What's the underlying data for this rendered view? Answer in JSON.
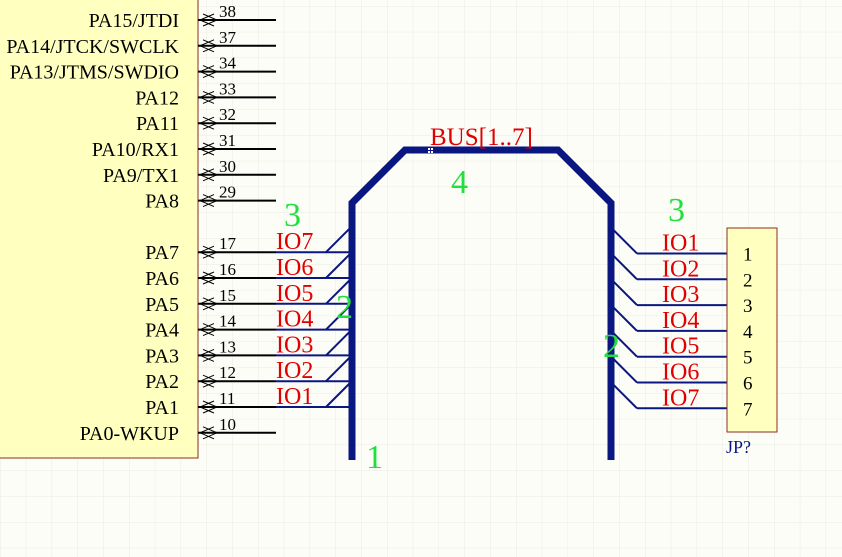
{
  "colors": {
    "background": "#fdfdf8",
    "grid": "#ebebe3",
    "component_fill": "#ffffc0",
    "component_stroke": "#8b2e1e",
    "pin_line": "#000000",
    "bus": "#0b1780",
    "net_label": "#e00000",
    "annotation": "#1fe03c",
    "designator": "#0b1780"
  },
  "mcu": {
    "pins": [
      {
        "name": "PA15/JTDI",
        "number": "38"
      },
      {
        "name": "PA14/JTCK/SWCLK",
        "number": "37"
      },
      {
        "name": "PA13/JTMS/SWDIO",
        "number": "34"
      },
      {
        "name": "PA12",
        "number": "33"
      },
      {
        "name": "PA11",
        "number": "32"
      },
      {
        "name": "PA10/RX1",
        "number": "31"
      },
      {
        "name": "PA9/TX1",
        "number": "30"
      },
      {
        "name": "PA8",
        "number": "29"
      },
      {
        "name": "",
        "number": ""
      },
      {
        "name": "PA7",
        "number": "17",
        "net": "IO7"
      },
      {
        "name": "PA6",
        "number": "16",
        "net": "IO6"
      },
      {
        "name": "PA5",
        "number": "15",
        "net": "IO5"
      },
      {
        "name": "PA4",
        "number": "14",
        "net": "IO4"
      },
      {
        "name": "PA3",
        "number": "13",
        "net": "IO3"
      },
      {
        "name": "PA2",
        "number": "12",
        "net": "IO2"
      },
      {
        "name": "PA1",
        "number": "11",
        "net": "IO1"
      },
      {
        "name": "PA0-WKUP",
        "number": "10"
      }
    ]
  },
  "bus": {
    "label": "BUS[1..7]"
  },
  "annotations": {
    "step1": "1",
    "step2_left": "2",
    "step2_right": "2",
    "step3_left": "3",
    "step3_right": "3",
    "step4": "4"
  },
  "connector": {
    "designator": "JP?",
    "pins": [
      {
        "number": "1",
        "net": "IO1"
      },
      {
        "number": "2",
        "net": "IO2"
      },
      {
        "number": "3",
        "net": "IO3"
      },
      {
        "number": "4",
        "net": "IO4"
      },
      {
        "number": "5",
        "net": "IO5"
      },
      {
        "number": "6",
        "net": "IO6"
      },
      {
        "number": "7",
        "net": "IO7"
      }
    ]
  }
}
